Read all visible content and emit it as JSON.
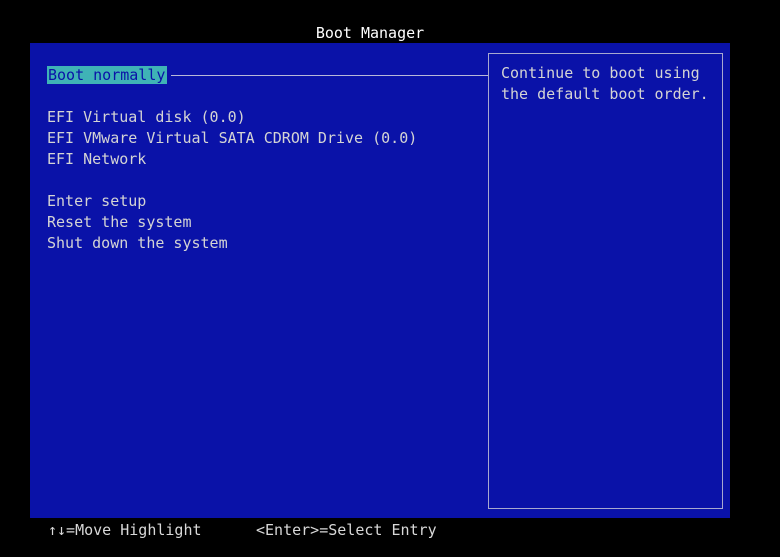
{
  "window": {
    "title": "Boot Manager"
  },
  "menu": {
    "selected": "Boot normally",
    "devices": [
      "EFI Virtual disk (0.0)",
      "EFI VMware Virtual SATA CDROM Drive (0.0)",
      "EFI Network"
    ],
    "actions": [
      "Enter setup",
      "Reset the system",
      "Shut down the system"
    ]
  },
  "help": {
    "text": "Continue to boot using\nthe default boot order."
  },
  "footer": {
    "move_hint": "↑↓=Move Highlight",
    "enter_hint": "<Enter>=Select Entry"
  },
  "colors": {
    "panel_background": "#0a12a8",
    "highlight": "#3fb3b6",
    "screen_background": "#000000"
  }
}
